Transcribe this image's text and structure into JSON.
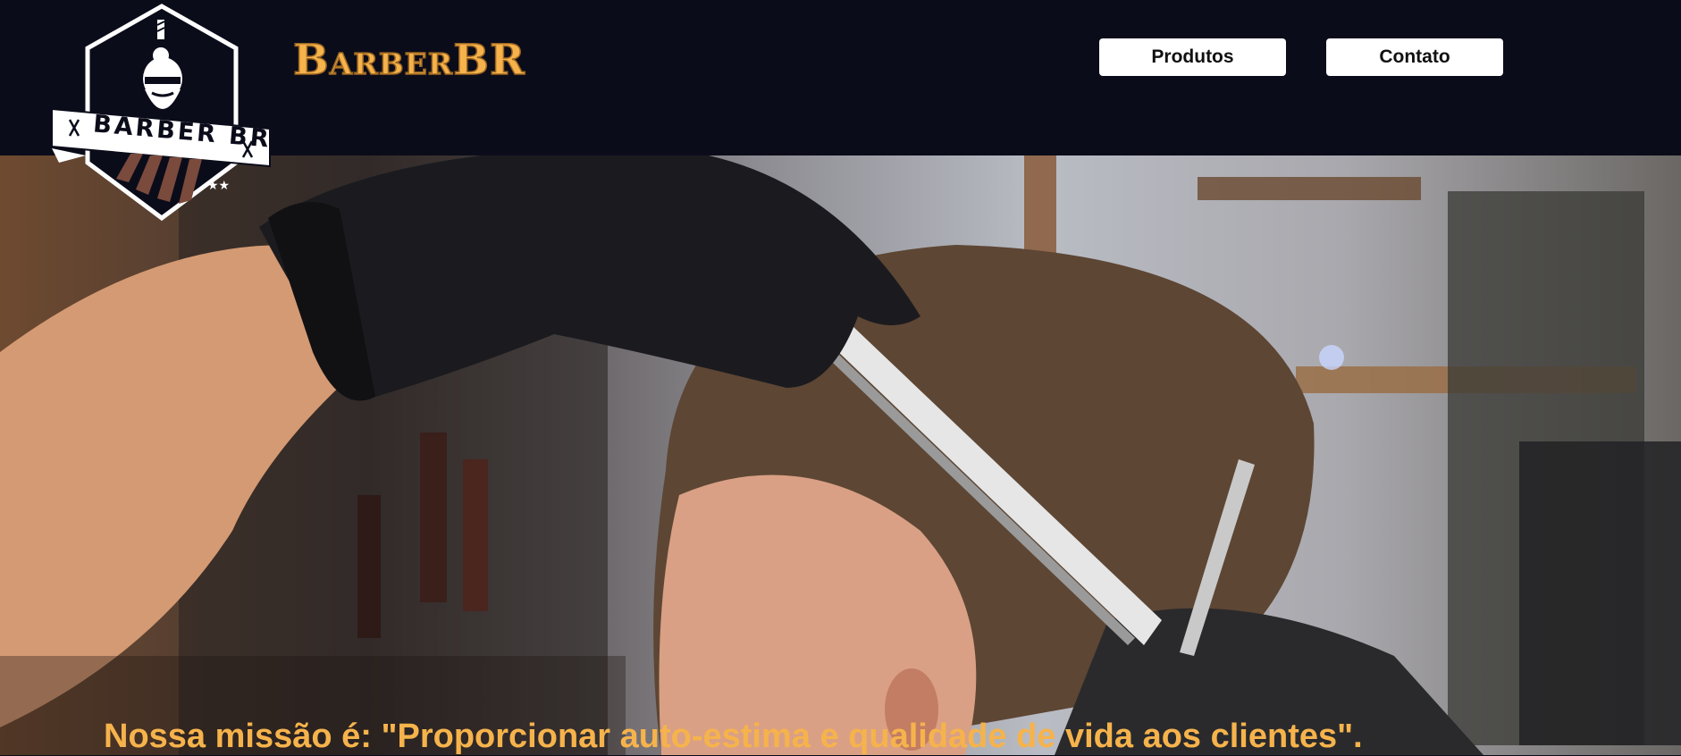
{
  "header": {
    "logo": {
      "badge_text": "BARBER BR",
      "icon": "bearded-man-with-sunglasses"
    },
    "brand_name": "BarberBR",
    "nav": [
      {
        "label": "Produtos"
      },
      {
        "label": "Contato"
      }
    ]
  },
  "hero": {
    "image": "barber combing a man's hair with a comb and scissors, black gloves",
    "mission": "Nossa missão é: \"Proporcionar auto-estima e qualidade de vida aos clientes\"."
  },
  "colors": {
    "header_bg": "#0b0c1a",
    "accent": "#f6b34c",
    "button_bg": "#ffffff"
  }
}
